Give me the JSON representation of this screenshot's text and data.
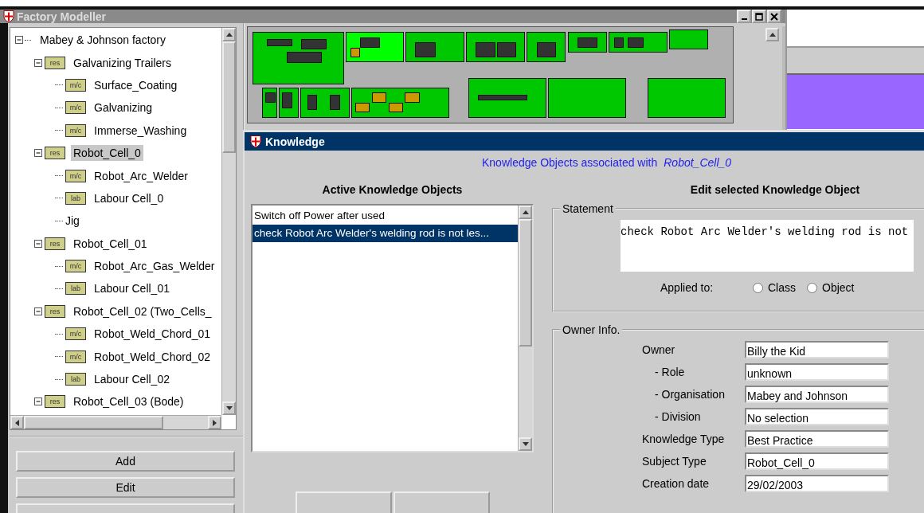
{
  "main_window": {
    "title": "Factory Modeller"
  },
  "tree": {
    "label": "Mabey & Johnson factory",
    "expanded": true,
    "selected": false,
    "children": [
      {
        "label": "Galvanizing Trailers",
        "tag": "res",
        "expanded": true,
        "selected": false,
        "children": [
          {
            "label": "Surface_Coating",
            "tag": "m/c",
            "selected": false
          },
          {
            "label": "Galvanizing",
            "tag": "m/c",
            "selected": false
          },
          {
            "label": "Immerse_Washing",
            "tag": "m/c",
            "selected": false
          }
        ]
      },
      {
        "label": "Robot_Cell_0",
        "tag": "res",
        "expanded": true,
        "selected": true,
        "children": [
          {
            "label": "Robot_Arc_Welder",
            "tag": "m/c",
            "selected": false
          },
          {
            "label": "Labour Cell_0",
            "tag": "lab",
            "selected": false
          },
          {
            "label": "Jig",
            "selected": false
          }
        ]
      },
      {
        "label": "Robot_Cell_01",
        "tag": "res",
        "expanded": true,
        "selected": false,
        "children": [
          {
            "label": "Robot_Arc_Gas_Welder",
            "tag": "m/c",
            "selected": false
          },
          {
            "label": "Labour Cell_01",
            "tag": "lab",
            "selected": false
          }
        ]
      },
      {
        "label": "Robot_Cell_02 (Two_Cells_",
        "tag": "res",
        "expanded": true,
        "selected": false,
        "children": [
          {
            "label": "Robot_Weld_Chord_01",
            "tag": "m/c",
            "selected": false
          },
          {
            "label": "Robot_Weld_Chord_02",
            "tag": "m/c",
            "selected": false
          },
          {
            "label": "Labour Cell_02",
            "tag": "lab",
            "selected": false
          }
        ]
      },
      {
        "label": "Robot_Cell_03 (Bode)",
        "tag": "res",
        "expanded": true,
        "selected": false
      }
    ]
  },
  "tree_buttons": [
    {
      "kind": "text",
      "label": "Add"
    },
    {
      "kind": "text",
      "label": "Edit"
    },
    {
      "kind": "blank"
    }
  ],
  "knowledge": {
    "title": "Knowledge",
    "header": "Knowledge Objects associated with",
    "subject": "Robot_Cell_0",
    "list_heading": "Active Knowledge Objects",
    "items": [
      {
        "text": "Switch off Power after used",
        "selected": false
      },
      {
        "text": "check Robot Arc Welder's welding rod is not les...",
        "selected": true
      }
    ],
    "edit_heading": "Edit selected Knowledge Object",
    "statement": {
      "legend": "Statement",
      "value": "check Robot Arc Welder's welding rod is not",
      "applied_label": "Applied to:",
      "options": [
        {
          "label": "Class",
          "selected": false
        },
        {
          "label": "Object",
          "selected": false
        }
      ]
    },
    "owner": {
      "legend": "Owner Info.",
      "fields": [
        {
          "label": "Owner",
          "kind": "main",
          "value": "Billy the Kid"
        },
        {
          "label": "- Role",
          "kind": "sub",
          "value": "unknown"
        },
        {
          "label": "- Organisation",
          "kind": "sub",
          "value": "Mabey and Johnson"
        },
        {
          "label": "- Division",
          "kind": "sub",
          "value": "No selection"
        },
        {
          "label": "Knowledge Type",
          "kind": "main",
          "value": "Best Practice"
        },
        {
          "label": "Subject Type",
          "kind": "main",
          "value": "Robot_Cell_0"
        },
        {
          "label": "Creation date",
          "kind": "main",
          "value": "29/02/2003"
        }
      ]
    },
    "buttons": [
      {
        "kind": "blank"
      },
      {
        "kind": "blank"
      }
    ]
  }
}
